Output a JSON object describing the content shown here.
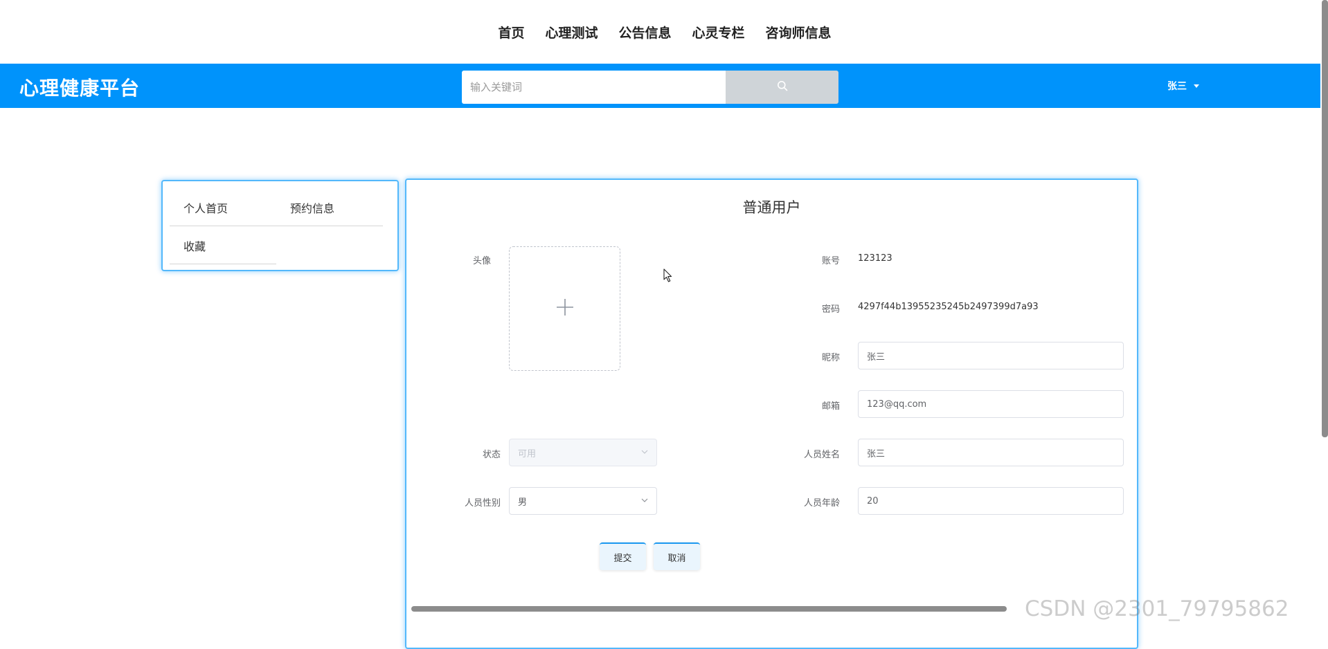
{
  "top_nav": {
    "items": [
      "首页",
      "心理测试",
      "公告信息",
      "心灵专栏",
      "咨询师信息"
    ]
  },
  "header": {
    "brand": "心理健康平台",
    "search_placeholder": "输入关键词",
    "username": "张三",
    "accent_color": "#0093fb"
  },
  "sidebar": {
    "items": [
      "个人首页",
      "预约信息",
      "收藏"
    ]
  },
  "form": {
    "title": "普通用户",
    "avatar_label": "头像",
    "account_label": "账号",
    "account_value": "123123",
    "password_label": "密码",
    "password_value": "4297f44b13955235245b2497399d7a93",
    "nickname_label": "昵称",
    "nickname_value": "张三",
    "email_label": "邮箱",
    "email_value": "123@qq.com",
    "status_label": "状态",
    "status_value": "可用",
    "name_label": "人员姓名",
    "name_value": "张三",
    "gender_label": "人员性别",
    "gender_value": "男",
    "age_label": "人员年龄",
    "age_value": "20",
    "submit_label": "提交",
    "cancel_label": "取消"
  },
  "watermark": "CSDN @2301_79795862"
}
